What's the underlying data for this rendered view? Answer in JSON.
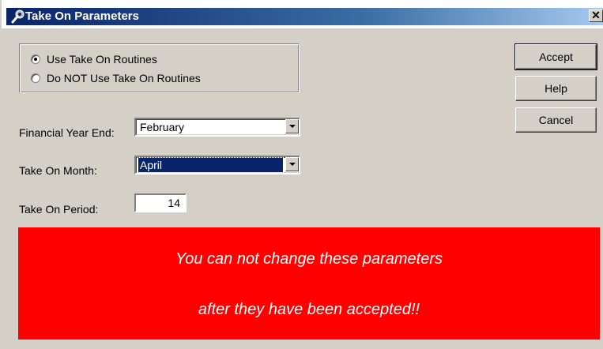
{
  "window": {
    "title": "Take On Parameters",
    "close_glyph": "✕"
  },
  "options": [
    {
      "label": "Use Take On Routines",
      "checked": true
    },
    {
      "label": "Do NOT Use Take On Routines",
      "checked": false
    }
  ],
  "fields": {
    "financial_year_end": {
      "label": "Financial Year End:",
      "value": "February"
    },
    "take_on_month": {
      "label": "Take On Month:",
      "value": "April"
    },
    "take_on_period": {
      "label": "Take On Period:",
      "value": "14"
    }
  },
  "buttons": {
    "accept": "Accept",
    "help": "Help",
    "cancel": "Cancel"
  },
  "warning": {
    "line1": "You can not change these parameters",
    "line2": "after they have been accepted!!",
    "bg_color": "#ff0000"
  }
}
